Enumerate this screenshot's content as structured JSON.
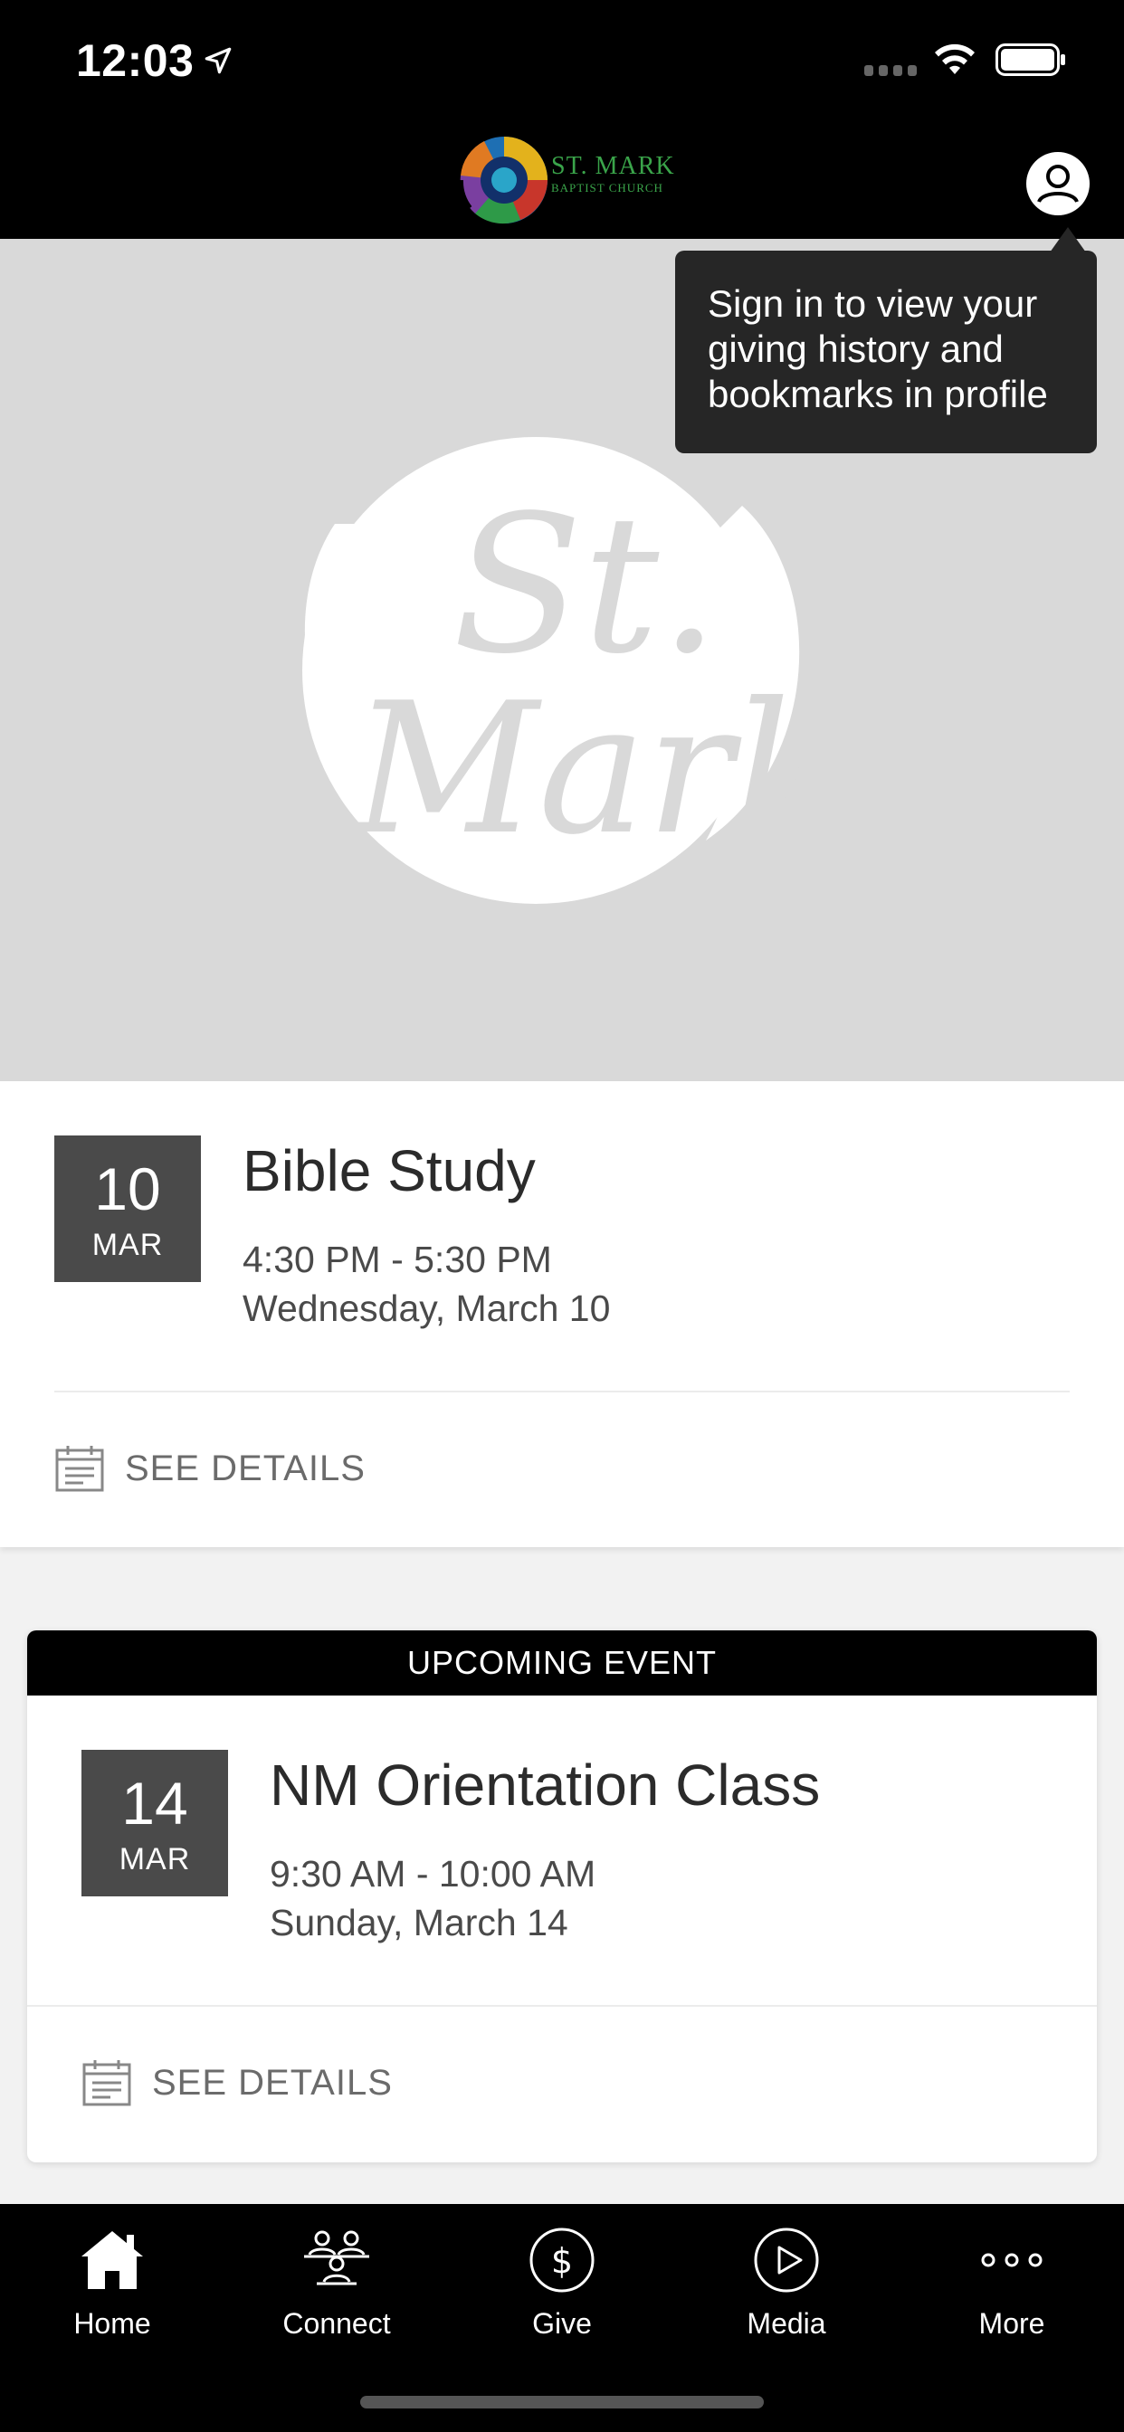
{
  "status_bar": {
    "time": "12:03"
  },
  "header": {
    "logo_text": "ST. MARK",
    "logo_subtext": "BAPTIST CHURCH",
    "profile_icon": "person-circle-icon"
  },
  "tooltip": {
    "text_line1": "Sign in to view your",
    "text_line2": "giving history and",
    "text_line3": "bookmarks in profile"
  },
  "hero": {
    "watermark_line1": "St.",
    "watermark_line2": "Mark"
  },
  "events": [
    {
      "day": "10",
      "month": "MAR",
      "title": "Bible Study",
      "time": "4:30 PM - 5:30 PM",
      "date": "Wednesday, March 10",
      "details_label": "SEE DETAILS"
    },
    {
      "banner": "UPCOMING EVENT",
      "day": "14",
      "month": "MAR",
      "title": "NM Orientation Class",
      "time": "9:30 AM - 10:00 AM",
      "date": "Sunday, March 14",
      "details_label": "SEE DETAILS"
    }
  ],
  "tab_bar": {
    "items": [
      {
        "label": "Home",
        "icon": "home-icon"
      },
      {
        "label": "Connect",
        "icon": "people-icon"
      },
      {
        "label": "Give",
        "icon": "dollar-icon"
      },
      {
        "label": "Media",
        "icon": "play-icon"
      },
      {
        "label": "More",
        "icon": "more-icon"
      }
    ]
  },
  "colors": {
    "header_bg": "#000000",
    "hero_bg": "#d9d9d9",
    "date_box": "#4a4a4a",
    "tooltip_bg": "#262626",
    "logo_green": "#3aa44a"
  }
}
